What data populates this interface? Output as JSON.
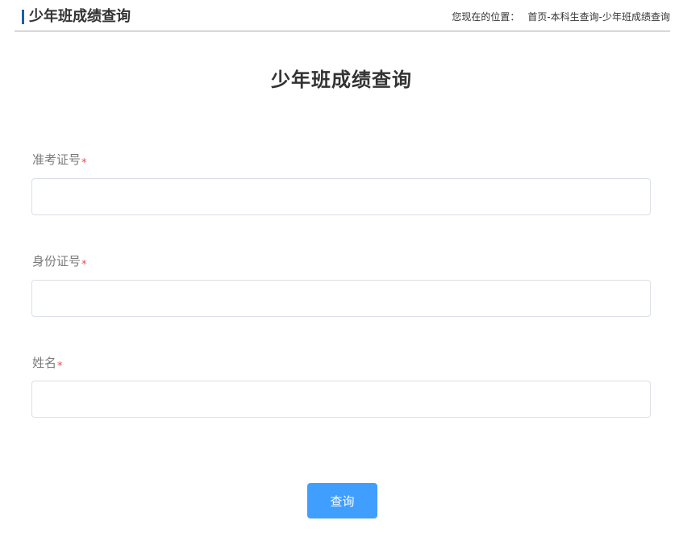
{
  "header": {
    "title": "少年班成绩查询",
    "breadcrumb_prefix": "您现在的位置：",
    "breadcrumb_path": "首页-本科生查询-少年班成绩查询",
    "accent_color": "#1f5fa8"
  },
  "page_title": "少年班成绩查询",
  "form": {
    "fields": [
      {
        "label": "准考证号",
        "required_mark": "*",
        "value": "",
        "placeholder": ""
      },
      {
        "label": "身份证号",
        "required_mark": "*",
        "value": "",
        "placeholder": ""
      },
      {
        "label": "姓名",
        "required_mark": "*",
        "value": "",
        "placeholder": ""
      }
    ],
    "submit_label": "查询",
    "submit_color": "#409eff",
    "required_color": "#e84c4c"
  }
}
